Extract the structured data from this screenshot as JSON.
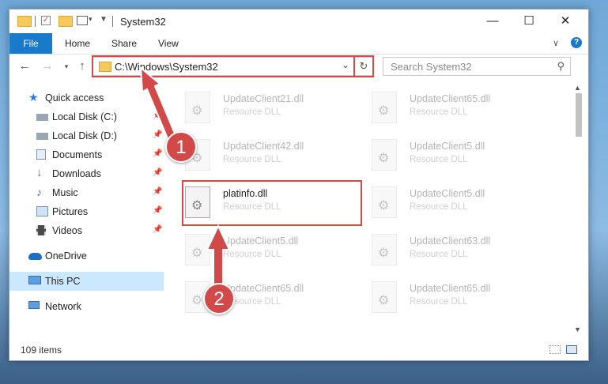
{
  "window": {
    "title": "System32",
    "controls": [
      "—",
      "☐",
      "✕"
    ]
  },
  "ribbon": {
    "file": "File",
    "tabs": [
      "Home",
      "Share",
      "View"
    ]
  },
  "address": {
    "path": "C:\\Windows\\System32"
  },
  "search": {
    "placeholder": "Search System32"
  },
  "sidebar": {
    "items": [
      {
        "label": "Quick access",
        "icon": "star-icon",
        "pinned": false
      },
      {
        "label": "Local Disk (C:)",
        "icon": "drive-icon",
        "pinned": true
      },
      {
        "label": "Local Disk (D:)",
        "icon": "drive-icon",
        "pinned": true
      },
      {
        "label": "Documents",
        "icon": "documents-icon",
        "pinned": true
      },
      {
        "label": "Downloads",
        "icon": "download-icon",
        "pinned": true
      },
      {
        "label": "Music",
        "icon": "music-icon",
        "pinned": true
      },
      {
        "label": "Pictures",
        "icon": "pictures-icon",
        "pinned": true
      },
      {
        "label": "Videos",
        "icon": "videos-icon",
        "pinned": true
      },
      {
        "label": "OneDrive",
        "icon": "cloud-icon",
        "pinned": false
      },
      {
        "label": "This PC",
        "icon": "computer-icon",
        "pinned": false
      },
      {
        "label": "Network",
        "icon": "network-icon",
        "pinned": false
      }
    ]
  },
  "files": [
    {
      "name": "UpdateClient21.dll",
      "type": "Resource DLL"
    },
    {
      "name": "UpdateClient65.dll",
      "type": "Resource DLL"
    },
    {
      "name": "UpdateClient42.dll",
      "type": "Resource DLL"
    },
    {
      "name": "UpdateClient5.dll",
      "type": "Resource DLL"
    },
    {
      "name": "platinfo.dll",
      "type": "Resource DLL"
    },
    {
      "name": "UpdateClient5.dll",
      "type": "Resource DLL"
    },
    {
      "name": "UpdateClient5.dll",
      "type": "Resource DLL"
    },
    {
      "name": "UpdateClient63.dll",
      "type": "Resource DLL"
    },
    {
      "name": "UpdateClient65.dll",
      "type": "Resource DLL"
    },
    {
      "name": "UpdateClient65.dll",
      "type": "Resource DLL"
    }
  ],
  "status": {
    "count": "109 items"
  },
  "callouts": [
    "1",
    "2"
  ],
  "colors": {
    "accent": "#1979ca",
    "callout": "#d14949",
    "selection": "#cce8ff"
  }
}
